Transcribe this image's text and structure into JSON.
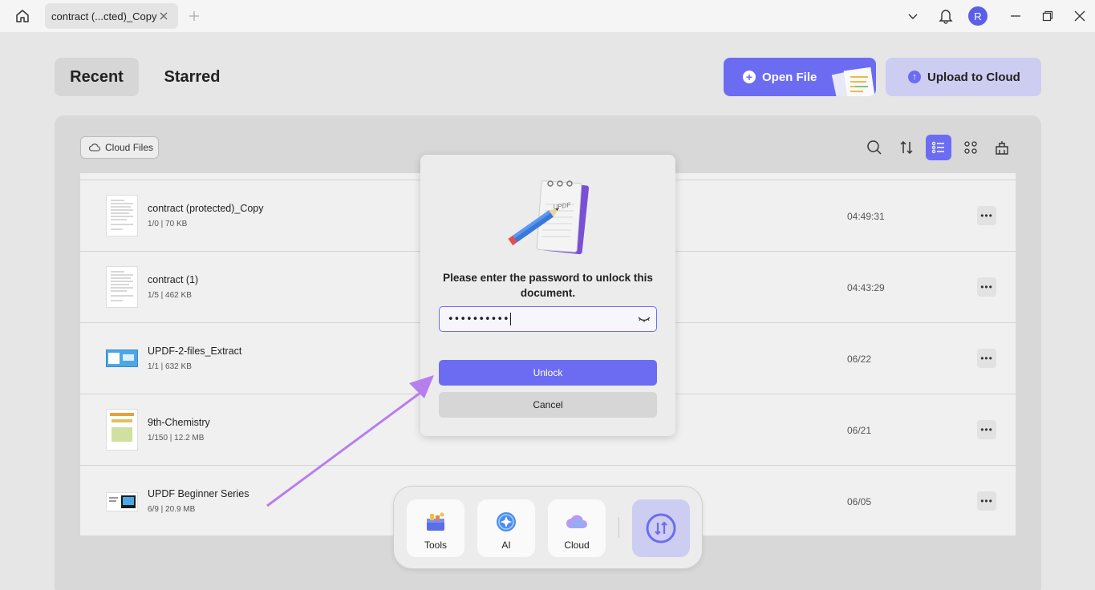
{
  "titlebar": {
    "tab_title": "contract (...cted)_Copy",
    "avatar_letter": "R"
  },
  "nav": {
    "recent": "Recent",
    "starred": "Starred",
    "open_file": "Open File",
    "upload_to_cloud": "Upload to Cloud",
    "cloud_files": "Cloud Files"
  },
  "files": [
    {
      "name": "contract (protected)_Copy",
      "meta": "1/0 | 70 KB",
      "time": "04:49:31"
    },
    {
      "name": "contract (1)",
      "meta": "1/5 | 462 KB",
      "time": "04:43:29"
    },
    {
      "name": "UPDF-2-files_Extract",
      "meta": "1/1 | 632 KB",
      "time": "06/22"
    },
    {
      "name": "9th-Chemistry",
      "meta": "1/150 | 12.2 MB",
      "time": "06/21"
    },
    {
      "name": "UPDF Beginner Series",
      "meta": "6/9 | 20.9 MB",
      "time": "06/05"
    }
  ],
  "dialog": {
    "message": "Please enter the password to unlock this document.",
    "password_value": "••••••••••",
    "unlock": "Unlock",
    "cancel": "Cancel"
  },
  "dock": {
    "tools": "Tools",
    "ai": "AI",
    "cloud": "Cloud"
  },
  "colors": {
    "accent": "#6c6cf2",
    "accent_light": "#cdcdf2",
    "arrow": "#b77ef0"
  }
}
